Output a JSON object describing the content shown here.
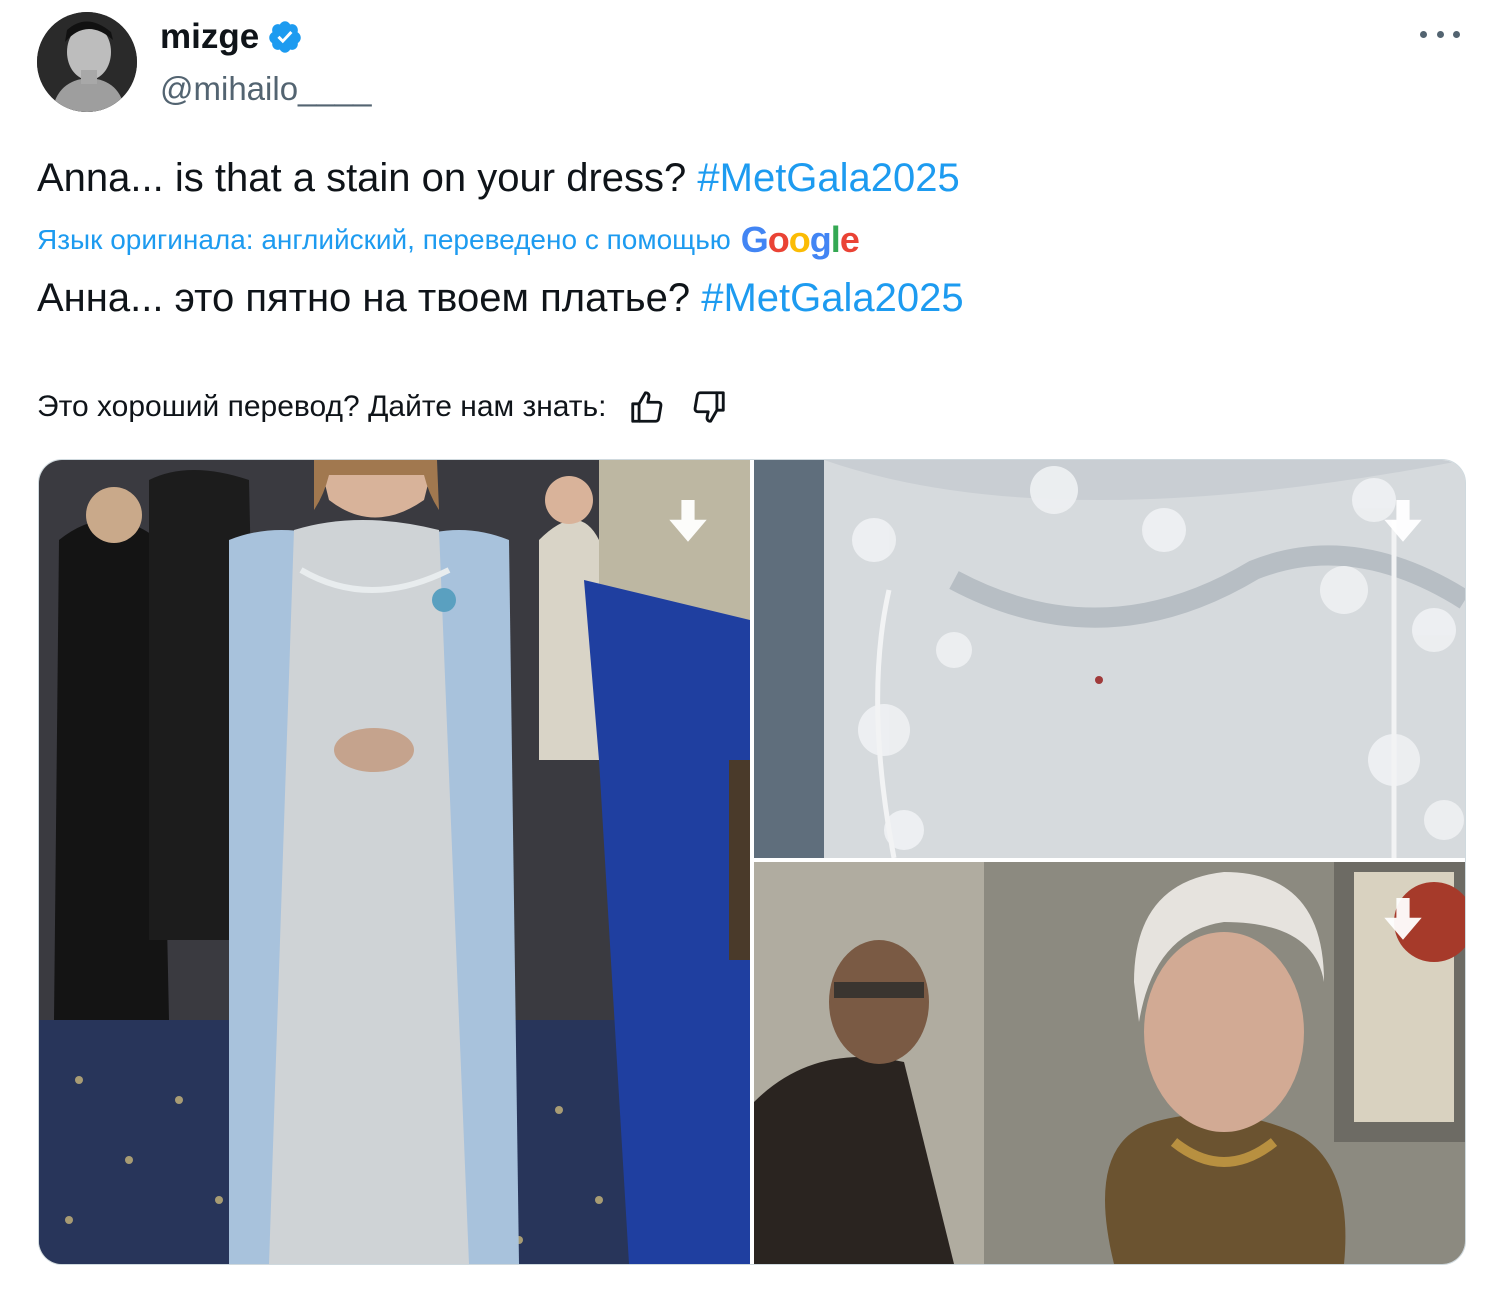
{
  "author": {
    "display_name": "mizge",
    "handle": "@mihailo____",
    "verified": true
  },
  "tweet": {
    "text_before": "Anna... is that a stain on your dress? ",
    "hashtag": "#MetGala2025"
  },
  "translation": {
    "note": "Язык оригинала: английский, переведено с помощью",
    "provider": "Google",
    "text_before": "Анна... это пятно на твоем платье? ",
    "hashtag": "#MetGala2025"
  },
  "feedback": {
    "prompt": "Это хороший перевод? Дайте нам знать:"
  },
  "icons": {
    "more": "more-dots-icon",
    "verified": "verified-badge-icon",
    "thumbs_up": "thumbs-up-icon",
    "thumbs_down": "thumbs-down-icon",
    "download": "download-arrow-icon"
  },
  "colors": {
    "accent": "#1d9bf0",
    "text": "#0f1419",
    "secondary": "#536471"
  }
}
